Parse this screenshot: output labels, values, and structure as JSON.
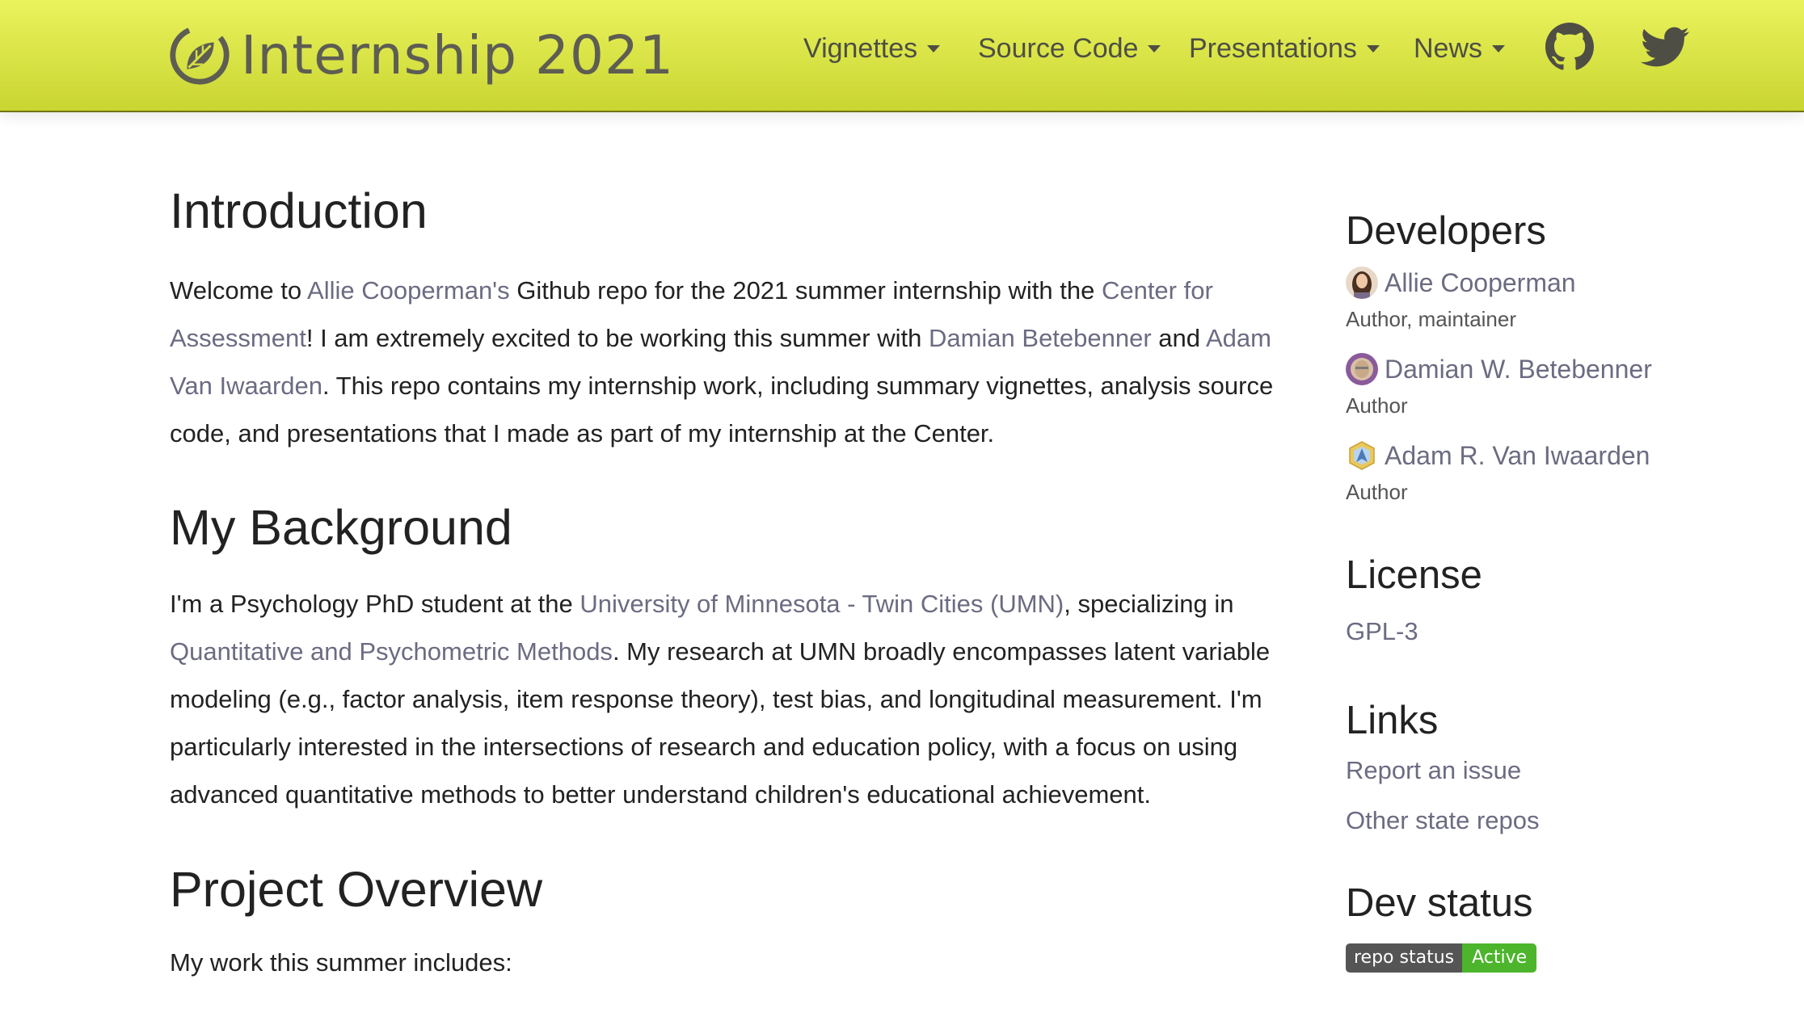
{
  "brand": {
    "title": "Internship 2021"
  },
  "nav": {
    "vignettes": "Vignettes",
    "source_code": "Source Code",
    "presentations": "Presentations",
    "news": "News",
    "icons": [
      "github-icon",
      "twitter-icon"
    ]
  },
  "colors": {
    "navbar_top": "#eaf35c",
    "navbar_bottom": "#c9d532",
    "link": "#6b6b82",
    "badge_active": "#4cb52c"
  },
  "intro": {
    "heading": "Introduction",
    "t1": "Welcome to ",
    "l1": "Allie Cooperman's",
    "t2": " Github repo for the 2021 summer internship with the ",
    "l2": "Center for Assessment",
    "t3": "! I am extremely excited to be working this summer with ",
    "l3": "Damian Betebenner",
    "t4": " and ",
    "l4": "Adam Van Iwaarden",
    "t5": ". This repo contains my internship work, including summary vignettes, analysis source code, and presentations that I made as part of my internship at the Center."
  },
  "background": {
    "heading": "My Background",
    "t1": "I'm a Psychology PhD student at the ",
    "l1": "University of Minnesota - Twin Cities (UMN)",
    "t2": ", specializing in ",
    "l2": "Quantitative and Psychometric Methods",
    "t3": ". My research at UMN broadly encompasses latent variable modeling (e.g., factor analysis, item response theory), test bias, and longitudinal measurement. I'm particularly interested in the intersections of research and education policy, with a focus on using advanced quantitative methods to better understand children's educational achievement."
  },
  "project": {
    "heading": "Project Overview",
    "text": "My work this summer includes:"
  },
  "sidebar": {
    "developers_heading": "Developers",
    "developers": [
      {
        "name": "Allie Cooperman",
        "role": "Author, maintainer"
      },
      {
        "name": "Damian W. Betebenner",
        "role": "Author"
      },
      {
        "name": "Adam R. Van Iwaarden",
        "role": "Author"
      }
    ],
    "license_heading": "License",
    "license": "GPL-3",
    "links_heading": "Links",
    "links": [
      "Report an issue",
      "Other state repos"
    ],
    "dev_status_heading": "Dev status",
    "badge_left": "repo status",
    "badge_right": "Active"
  }
}
